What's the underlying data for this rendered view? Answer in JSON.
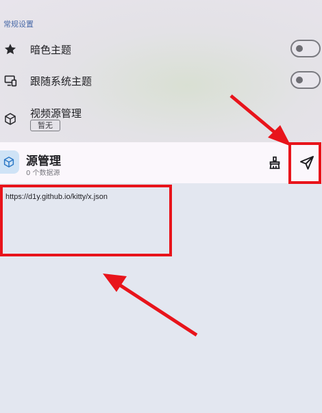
{
  "settings": {
    "section_title": "常规设置",
    "dark_theme_label": "暗色主题",
    "follow_system_label": "跟随系统主题",
    "video_source_label": "视频源管理",
    "video_source_badge": "暂无"
  },
  "header": {
    "title": "源管理",
    "subtitle": "0 个数据源"
  },
  "content": {
    "url": "https://d1y.github.io/kitty/x.json"
  },
  "colors": {
    "annotation_red": "#e8141b",
    "accent_blue": "#4a6aa8"
  }
}
